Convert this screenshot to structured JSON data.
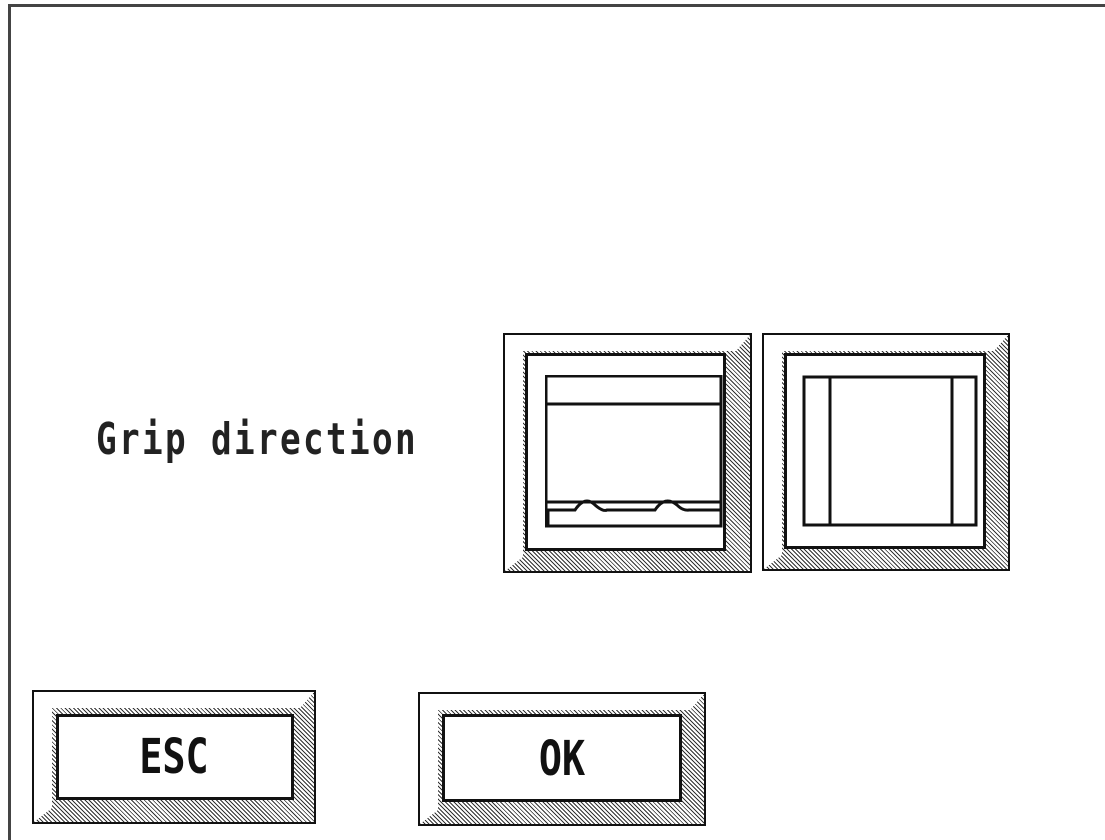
{
  "dialog": {
    "grip_label": "Grip direction",
    "options": [
      {
        "name": "grip-top-edge-option",
        "icon": "sheet-gripper-top-icon"
      },
      {
        "name": "grip-side-edge-option",
        "icon": "sheet-gripper-side-icon"
      }
    ]
  },
  "buttons": {
    "esc_label": "ESC",
    "ok_label": "OK"
  }
}
